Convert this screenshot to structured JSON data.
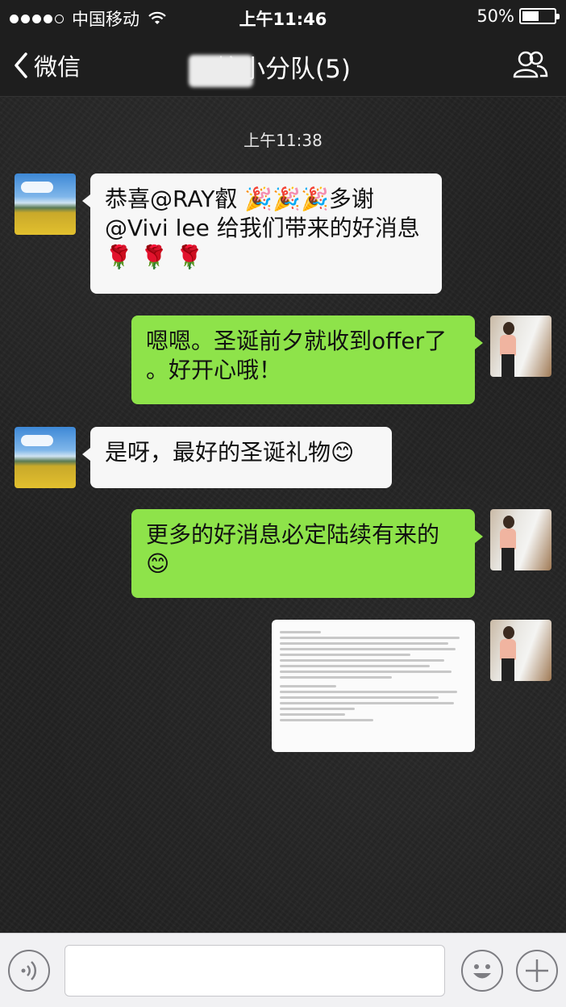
{
  "status_bar": {
    "carrier": "中国移动",
    "time": "上午11:46",
    "battery": "50%"
  },
  "nav": {
    "back_label": "微信",
    "title": "校小分队(5)"
  },
  "chat": {
    "time_divider": "上午11:38",
    "messages": [
      {
        "side": "left",
        "lines": [
          "恭喜@RAY叡 🎉🎉🎉多谢",
          "@Vivi lee 给我们带来的好消息",
          "🌹 🌹 🌹"
        ]
      },
      {
        "side": "right",
        "lines": [
          "嗯嗯。圣诞前夕就收到offer了",
          "。好开心哦！"
        ]
      },
      {
        "side": "left",
        "lines": [
          "是呀，最好的圣诞礼物😊"
        ]
      },
      {
        "side": "right",
        "lines": [
          "更多的好消息必定陆续有来的",
          "😊"
        ]
      },
      {
        "side": "right",
        "type": "image",
        "icon": "document-screenshot"
      }
    ]
  },
  "toolbar": {
    "input_value": "",
    "icons": [
      "voice-icon",
      "emoji-icon",
      "plus-icon"
    ]
  },
  "colors": {
    "bar_bg": "#1e1e1e",
    "bubble_self": "#8ee34a",
    "bubble_other": "#f7f7f7"
  }
}
